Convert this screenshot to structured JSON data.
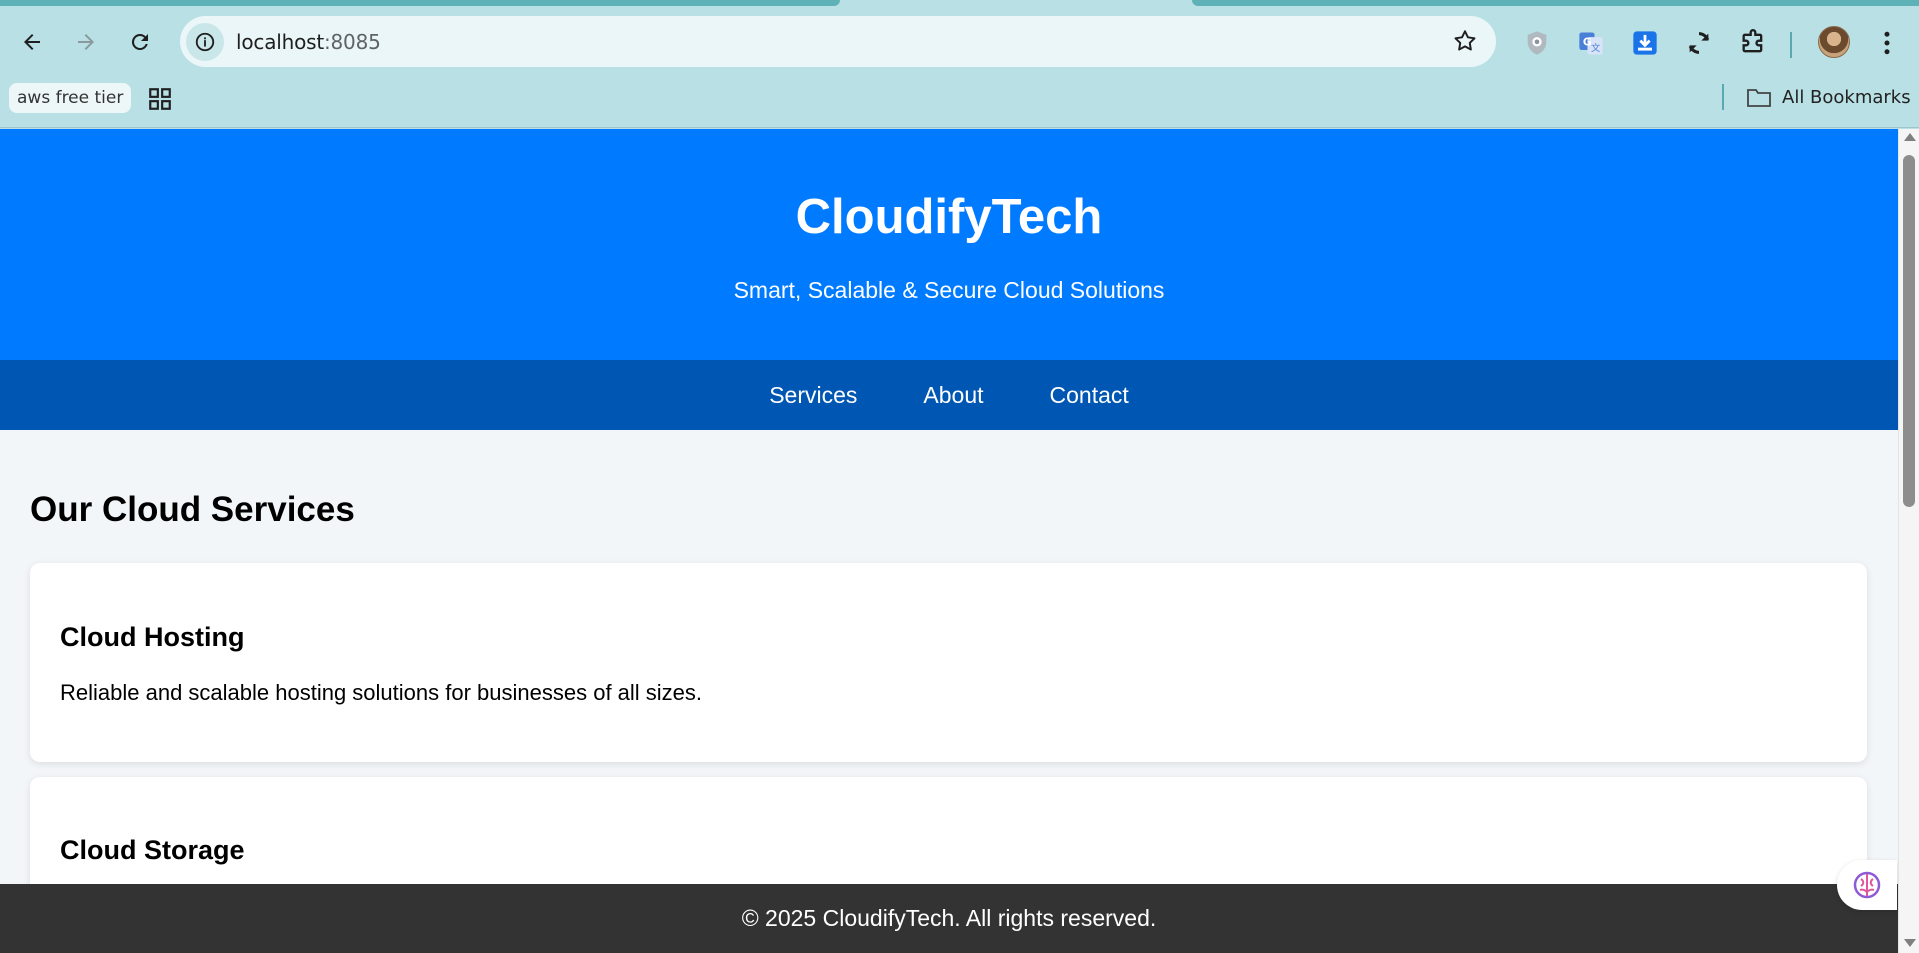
{
  "browser": {
    "url_host": "localhost",
    "url_port": ":8085",
    "bookmarks": [
      "aws free tier"
    ],
    "all_bookmarks_label": "All Bookmarks",
    "icons": [
      "back-icon",
      "forward-icon",
      "reload-icon",
      "site-info-icon",
      "star-icon",
      "privacy-extension-icon",
      "translate-extension-icon",
      "download-extension-icon",
      "sync-extension-icon",
      "extensions-icon",
      "avatar",
      "menu-icon",
      "apps-icon",
      "folder-icon"
    ]
  },
  "site": {
    "title": "CloudifyTech",
    "tagline": "Smart, Scalable & Secure Cloud Solutions",
    "nav": [
      "Services",
      "About",
      "Contact"
    ],
    "section_title": "Our Cloud Services",
    "services": [
      {
        "name": "Cloud Hosting",
        "description": "Reliable and scalable hosting solutions for businesses of all sizes."
      },
      {
        "name": "Cloud Storage",
        "description": ""
      }
    ],
    "footer": "© 2025 CloudifyTech. All rights reserved.",
    "colors": {
      "header": "#007bff",
      "nav": "#0056b3",
      "footer": "#333333",
      "background": "#f3f6f9"
    }
  }
}
